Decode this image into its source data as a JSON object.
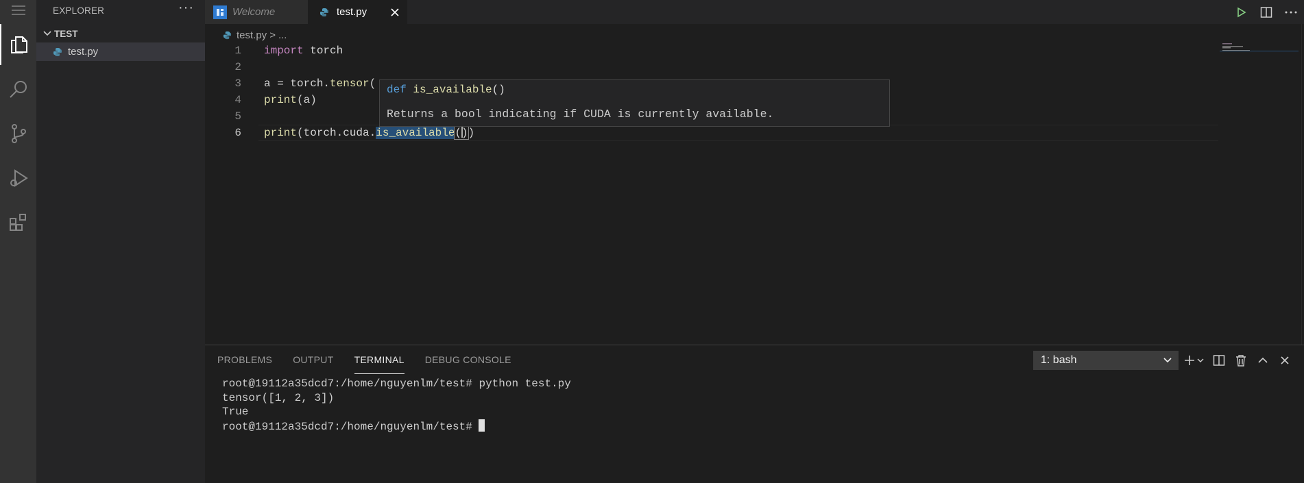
{
  "activity_bar": {
    "items": [
      {
        "name": "explorer-icon"
      },
      {
        "name": "search-icon"
      },
      {
        "name": "source-control-icon"
      },
      {
        "name": "run-debug-icon"
      },
      {
        "name": "extensions-icon"
      }
    ]
  },
  "sidebar": {
    "title": "EXPLORER",
    "more_label": "···",
    "folder": "TEST",
    "files": [
      {
        "label": "test.py"
      }
    ]
  },
  "tabs": [
    {
      "label": "Welcome"
    },
    {
      "label": "test.py"
    }
  ],
  "breadcrumb": {
    "file": "test.py",
    "separator": ">",
    "more": "..."
  },
  "editor": {
    "line_numbers": [
      "1",
      "2",
      "3",
      "4",
      "5",
      "6"
    ],
    "lines": {
      "l1_kw": "import",
      "l1_rest": " torch",
      "l3_a": "a = torch.",
      "l3_fn": "tensor",
      "l3_rest": "(",
      "l4_fn": "print",
      "l4_rest": "(a)",
      "l6_fn": "print",
      "l6_mid": "(torch.cuda.",
      "l6_hl": "is_available",
      "l6_end": "()",
      "l6_close": ")"
    }
  },
  "hover": {
    "keyword": "def",
    "name": "is_available",
    "parens": "()",
    "doc": "Returns a bool indicating if CUDA is currently available."
  },
  "panel": {
    "tabs": [
      "PROBLEMS",
      "OUTPUT",
      "TERMINAL",
      "DEBUG CONSOLE"
    ],
    "active_tab": "TERMINAL",
    "terminal_select": "1: bash",
    "terminal_lines": [
      "root@19112a35dcd7:/home/nguyenlm/test# python test.py",
      "tensor([1, 2, 3])",
      "True",
      "root@19112a35dcd7:/home/nguyenlm/test# "
    ]
  },
  "colors": {
    "activity_bar": "#333333",
    "sidebar": "#252526",
    "editor": "#1e1e1e",
    "keyword": "#c586c0",
    "function": "#dcdcaa",
    "def_keyword": "#569cd6"
  }
}
